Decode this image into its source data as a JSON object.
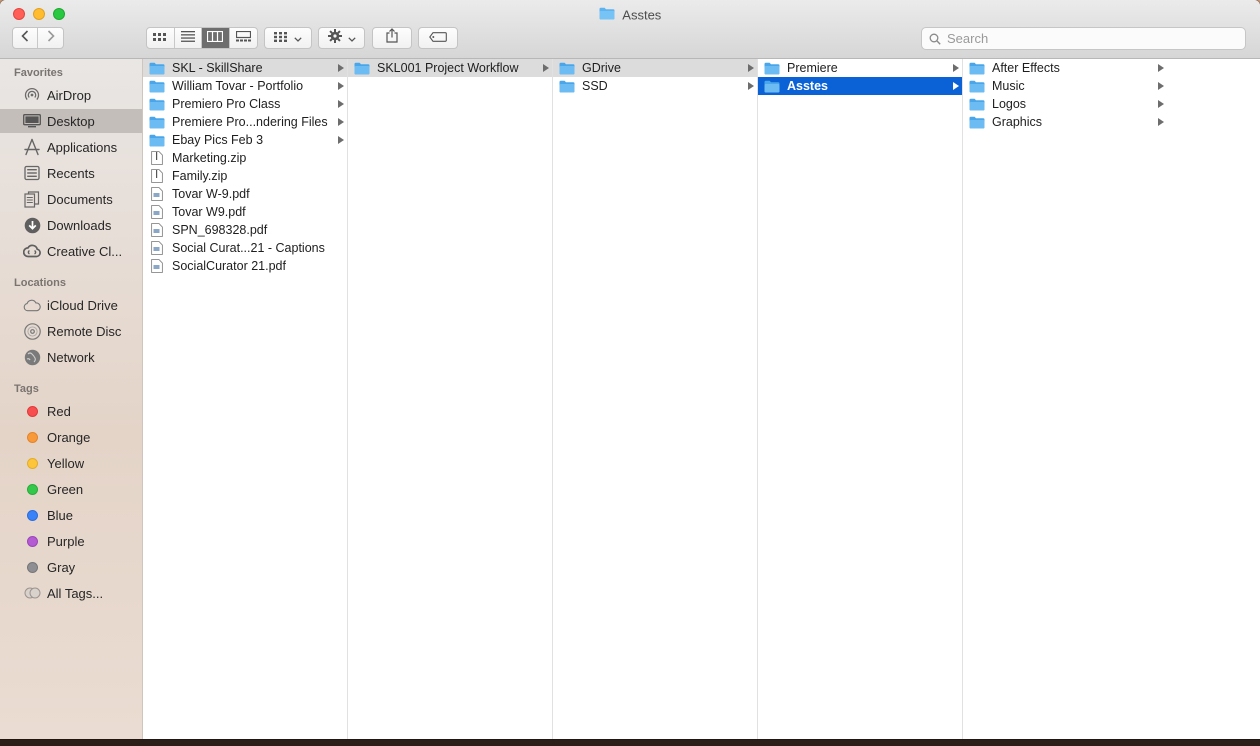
{
  "window": {
    "title": "Asstes"
  },
  "toolbar": {
    "back_icon": "chevron-left-icon",
    "forward_icon": "chevron-right-icon",
    "view_modes": [
      "icon-view-icon",
      "list-view-icon",
      "column-view-icon",
      "gallery-view-icon"
    ],
    "active_view": "column",
    "group_icon": "group-by-icon",
    "action_icon": "gear-icon",
    "share_icon": "share-icon",
    "tag_icon": "tag-icon"
  },
  "search": {
    "placeholder": "Search"
  },
  "sidebar": {
    "favorites_header": "Favorites",
    "favorites": [
      {
        "label": "AirDrop",
        "icon": "airdrop-icon"
      },
      {
        "label": "Desktop",
        "icon": "desktop-icon",
        "selected": true
      },
      {
        "label": "Applications",
        "icon": "applications-icon"
      },
      {
        "label": "Recents",
        "icon": "recents-icon"
      },
      {
        "label": "Documents",
        "icon": "documents-icon"
      },
      {
        "label": "Downloads",
        "icon": "downloads-icon"
      },
      {
        "label": "Creative Cl...",
        "icon": "creative-cloud-icon"
      }
    ],
    "locations_header": "Locations",
    "locations": [
      {
        "label": "iCloud Drive",
        "icon": "cloud-icon"
      },
      {
        "label": "Remote Disc",
        "icon": "disc-icon"
      },
      {
        "label": "Network",
        "icon": "network-icon"
      }
    ],
    "tags_header": "Tags",
    "tags": [
      {
        "label": "Red",
        "color": "#f74f4f"
      },
      {
        "label": "Orange",
        "color": "#f99a3a"
      },
      {
        "label": "Yellow",
        "color": "#fcc53a"
      },
      {
        "label": "Green",
        "color": "#34c84a"
      },
      {
        "label": "Blue",
        "color": "#3a82f7"
      },
      {
        "label": "Purple",
        "color": "#b45ad3"
      },
      {
        "label": "Gray",
        "color": "#8e8e93"
      },
      {
        "label": "All Tags...",
        "color": "#d6cfc9"
      }
    ]
  },
  "columns": [
    {
      "items": [
        {
          "label": "SKL - SkillShare",
          "type": "folder",
          "has_children": true,
          "state": "path"
        },
        {
          "label": "William Tovar - Portfolio",
          "type": "folder",
          "has_children": true
        },
        {
          "label": "Premiero Pro Class",
          "type": "folder",
          "has_children": true
        },
        {
          "label": "Premiere Pro...ndering Files",
          "type": "folder",
          "has_children": true
        },
        {
          "label": "Ebay Pics Feb 3",
          "type": "folder",
          "has_children": true
        },
        {
          "label": "Marketing.zip",
          "type": "zip"
        },
        {
          "label": "Family.zip",
          "type": "zip"
        },
        {
          "label": "Tovar W-9.pdf",
          "type": "pdf"
        },
        {
          "label": "Tovar W9.pdf",
          "type": "pdf"
        },
        {
          "label": "SPN_698328.pdf",
          "type": "pdf"
        },
        {
          "label": "Social Curat...21 - Captions",
          "type": "pdf"
        },
        {
          "label": "SocialCurator 21.pdf",
          "type": "pdf"
        }
      ]
    },
    {
      "items": [
        {
          "label": "SKL001 Project Workflow",
          "type": "folder",
          "has_children": true,
          "state": "path"
        }
      ]
    },
    {
      "items": [
        {
          "label": "GDrive",
          "type": "folder",
          "has_children": true,
          "state": "path"
        },
        {
          "label": "SSD",
          "type": "folder",
          "has_children": true
        }
      ]
    },
    {
      "items": [
        {
          "label": "Premiere",
          "type": "folder",
          "has_children": true
        },
        {
          "label": "Asstes",
          "type": "folder",
          "has_children": true,
          "state": "selected"
        }
      ]
    },
    {
      "items": [
        {
          "label": "After Effects",
          "type": "folder",
          "has_children": true
        },
        {
          "label": "Music",
          "type": "folder",
          "has_children": true
        },
        {
          "label": "Logos",
          "type": "folder",
          "has_children": true
        },
        {
          "label": "Graphics",
          "type": "folder",
          "has_children": true
        }
      ]
    }
  ]
}
